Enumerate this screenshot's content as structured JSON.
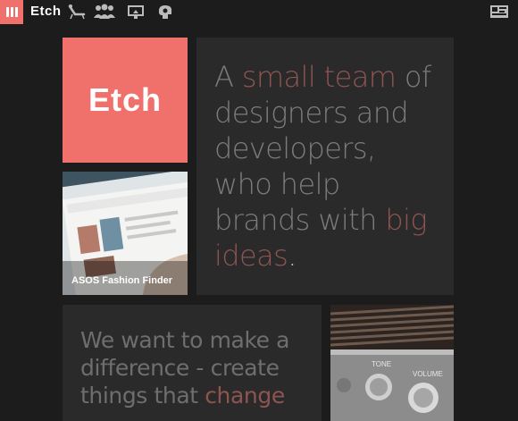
{
  "header": {
    "brand": "Etch",
    "nav_icons": [
      "menu-icon",
      "lounge-chair-icon",
      "team-icon",
      "monitor-icon",
      "head-icon",
      "contact-card-icon"
    ]
  },
  "tiles": {
    "logo_text": "Etch",
    "intro": {
      "part1": "A ",
      "accent1": "small team",
      "part2": " of designers and developers, who help brands with ",
      "accent2": "big ideas",
      "end": "."
    },
    "project_caption": "ASOS Fashion Finder",
    "mission": {
      "part1": "We want to make a difference - create things that ",
      "accent": "change"
    },
    "radio_labels": {
      "tone": "TONE",
      "volume": "VOLUME"
    }
  },
  "colors": {
    "brand_coral": "#f0706b",
    "background": "#1c1c1c",
    "tile_dark": "#2a2a2a",
    "accent_text": "#8e5452"
  }
}
